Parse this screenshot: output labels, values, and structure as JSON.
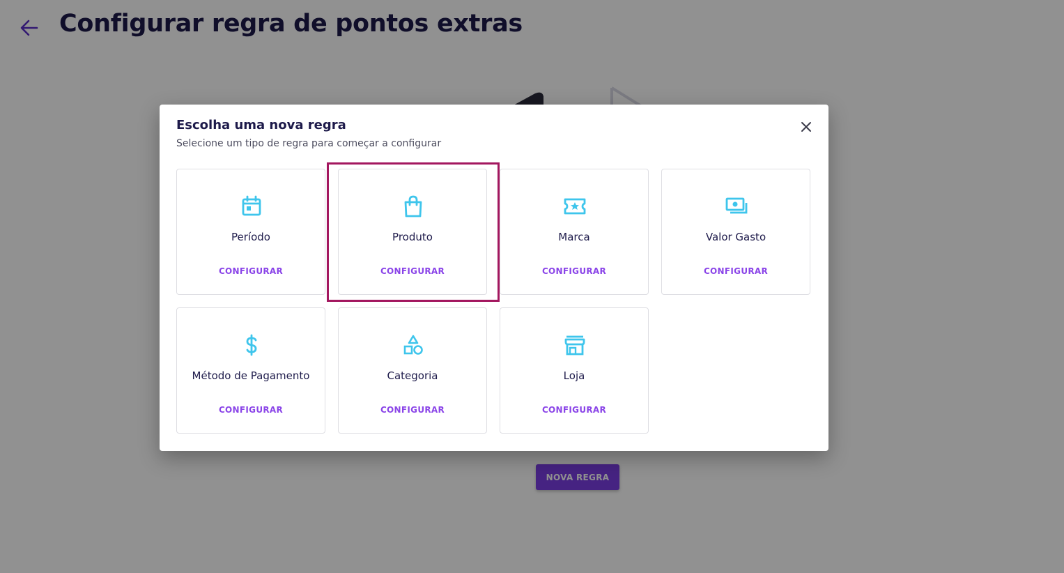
{
  "page": {
    "title": "Configurar regra de pontos extras",
    "new_rule_button": "NOVA REGRA"
  },
  "modal": {
    "title": "Escolha uma nova regra",
    "subtitle": "Selecione um tipo de regra para começar a configurar",
    "close_icon": "close-icon",
    "highlighted_card": "Produto",
    "cards": [
      {
        "label": "Período",
        "icon": "calendar-icon",
        "action": "CONFIGURAR"
      },
      {
        "label": "Produto",
        "icon": "shopping-bag-icon",
        "action": "CONFIGURAR"
      },
      {
        "label": "Marca",
        "icon": "ticket-star-icon",
        "action": "CONFIGURAR"
      },
      {
        "label": "Valor Gasto",
        "icon": "money-icon",
        "action": "CONFIGURAR"
      },
      {
        "label": "Método de Pagamento",
        "icon": "dollar-icon",
        "action": "CONFIGURAR"
      },
      {
        "label": "Categoria",
        "icon": "shapes-icon",
        "action": "CONFIGURAR"
      },
      {
        "label": "Loja",
        "icon": "store-icon",
        "action": "CONFIGURAR"
      }
    ]
  },
  "colors": {
    "title_text": "#1d1a4a",
    "accent_purple": "#8a44e8",
    "icon_blue": "#3ec5ec",
    "highlight_border": "#a3175f",
    "button_purple": "#7b3fe4"
  }
}
